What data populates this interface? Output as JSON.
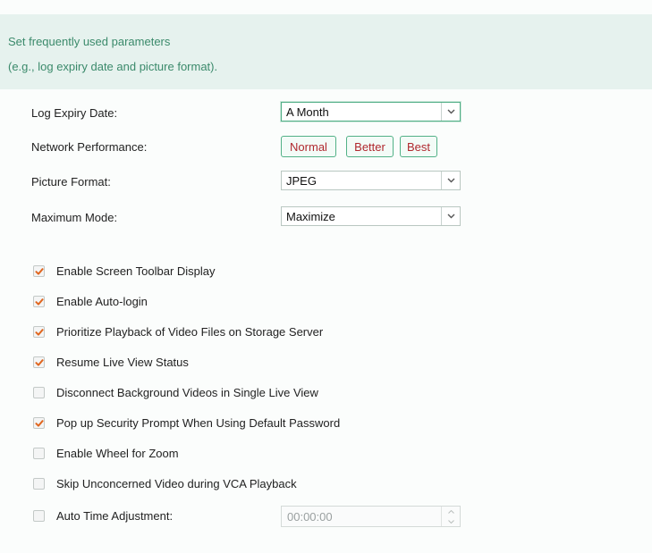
{
  "banner": {
    "line1": "Set frequently used parameters",
    "line2": "(e.g., log expiry date and picture format)."
  },
  "settings": {
    "log_expiry": {
      "label": "Log Expiry Date:",
      "value": "A Month"
    },
    "network_performance": {
      "label": "Network Performance:",
      "options": [
        "Normal",
        "Better",
        "Best"
      ]
    },
    "picture_format": {
      "label": "Picture Format:",
      "value": "JPEG"
    },
    "maximum_mode": {
      "label": "Maximum Mode:",
      "value": "Maximize"
    }
  },
  "options": [
    {
      "label": "Enable Screen Toolbar Display",
      "checked": true
    },
    {
      "label": "Enable Auto-login",
      "checked": true
    },
    {
      "label": "Prioritize Playback of Video Files on Storage Server",
      "checked": true
    },
    {
      "label": "Resume Live View Status",
      "checked": true
    },
    {
      "label": "Disconnect Background Videos in Single Live View",
      "checked": false
    },
    {
      "label": "Pop up Security Prompt When Using Default Password",
      "checked": true
    },
    {
      "label": "Enable Wheel for Zoom",
      "checked": false
    },
    {
      "label": "Skip Unconcerned Video during VCA Playback",
      "checked": false
    },
    {
      "label": "Auto Time Adjustment:",
      "checked": false
    }
  ],
  "auto_time": {
    "value": "00:00:00"
  },
  "colors": {
    "accent": "#4fae85",
    "check": "#e0661f",
    "banner": "#e6f2ee",
    "banner_text": "#3b8a6b",
    "button_text": "#b0282e"
  }
}
